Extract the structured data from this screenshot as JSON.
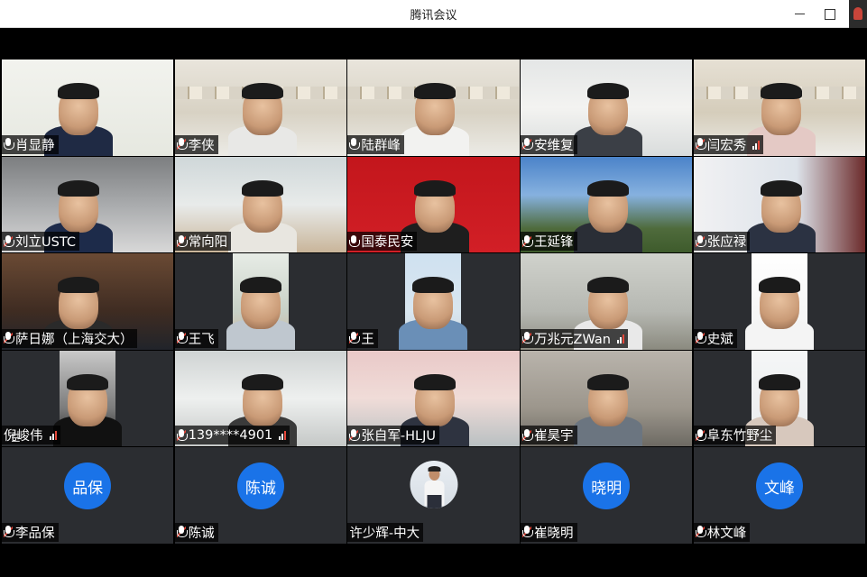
{
  "window": {
    "title": "腾讯会议",
    "controls": {
      "minimize": "minimize-icon",
      "maximize": "maximize-icon",
      "close": "close-icon"
    }
  },
  "colors": {
    "avatar_blue": "#1a73e8",
    "mute_red": "#e5483b",
    "tile_bg": "#2b2d31"
  },
  "participants": [
    {
      "name": "肖显静",
      "mic": "on",
      "signal": false,
      "type": "video"
    },
    {
      "name": "李侠",
      "mic": "muted",
      "signal": false,
      "type": "video"
    },
    {
      "name": "陆群峰",
      "mic": "on",
      "signal": false,
      "type": "video"
    },
    {
      "name": "安维复",
      "mic": "muted",
      "signal": false,
      "type": "video"
    },
    {
      "name": "闫宏秀",
      "mic": "muted",
      "signal": true,
      "type": "video"
    },
    {
      "name": "刘立USTC",
      "mic": "muted",
      "signal": false,
      "type": "video"
    },
    {
      "name": "常向阳",
      "mic": "muted",
      "signal": false,
      "type": "video"
    },
    {
      "name": "国泰民安",
      "mic": "on",
      "signal": false,
      "type": "video"
    },
    {
      "name": "王延锋",
      "mic": "muted",
      "signal": false,
      "type": "video"
    },
    {
      "name": "张应禄",
      "mic": "muted",
      "signal": false,
      "type": "video"
    },
    {
      "name": "萨日娜（上海交大）",
      "mic": "muted",
      "signal": false,
      "type": "video"
    },
    {
      "name": "王飞",
      "mic": "muted",
      "signal": false,
      "type": "video"
    },
    {
      "name": "王",
      "mic": "muted",
      "signal": false,
      "type": "video"
    },
    {
      "name": "万兆元ZWan",
      "mic": "muted",
      "signal": true,
      "type": "video"
    },
    {
      "name": "史斌",
      "mic": "muted",
      "signal": false,
      "type": "video"
    },
    {
      "name": "倪峻伟",
      "mic": "none",
      "signal": true,
      "type": "video"
    },
    {
      "name": "139****4901",
      "mic": "muted",
      "signal": true,
      "type": "video"
    },
    {
      "name": "张自军-HLJU",
      "mic": "muted",
      "signal": false,
      "type": "video"
    },
    {
      "name": "崔昊宇",
      "mic": "muted",
      "signal": false,
      "type": "video"
    },
    {
      "name": "阜东竹野尘",
      "mic": "muted",
      "signal": false,
      "type": "video"
    },
    {
      "name": "李品保",
      "mic": "muted",
      "signal": false,
      "type": "avatar",
      "initials": "品保"
    },
    {
      "name": "陈诚",
      "mic": "muted",
      "signal": false,
      "type": "avatar",
      "initials": "陈诚"
    },
    {
      "name": "许少辉-中大",
      "mic": "none",
      "signal": false,
      "type": "photo"
    },
    {
      "name": "崔晓明",
      "mic": "muted",
      "signal": false,
      "type": "avatar",
      "initials": "晓明"
    },
    {
      "name": "林文峰",
      "mic": "muted",
      "signal": false,
      "type": "avatar",
      "initials": "文峰"
    }
  ]
}
